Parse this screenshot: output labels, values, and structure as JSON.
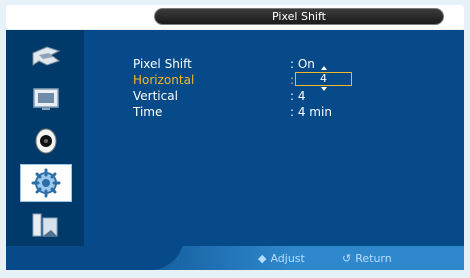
{
  "title": "Pixel Shift",
  "sidebar": {
    "icons": [
      {
        "name": "input-icon"
      },
      {
        "name": "picture-icon"
      },
      {
        "name": "sound-icon"
      },
      {
        "name": "setup-icon",
        "selected": true
      },
      {
        "name": "multi-control-icon"
      }
    ]
  },
  "menu": {
    "items": [
      {
        "label": "Pixel Shift",
        "value": ": On"
      },
      {
        "label": "Horizontal",
        "value": ":",
        "edit_value": "4",
        "active": true
      },
      {
        "label": "Vertical",
        "value": ": 4"
      },
      {
        "label": "Time",
        "value": ": 4 min"
      }
    ]
  },
  "footer": {
    "adjust_icon": "◆",
    "adjust_label": "Adjust",
    "return_icon": "↺",
    "return_label": "Return"
  },
  "colors": {
    "panel": "#074a8a",
    "sidebar": "#003a6b",
    "highlight": "#f5b629",
    "text": "#ffffff"
  }
}
